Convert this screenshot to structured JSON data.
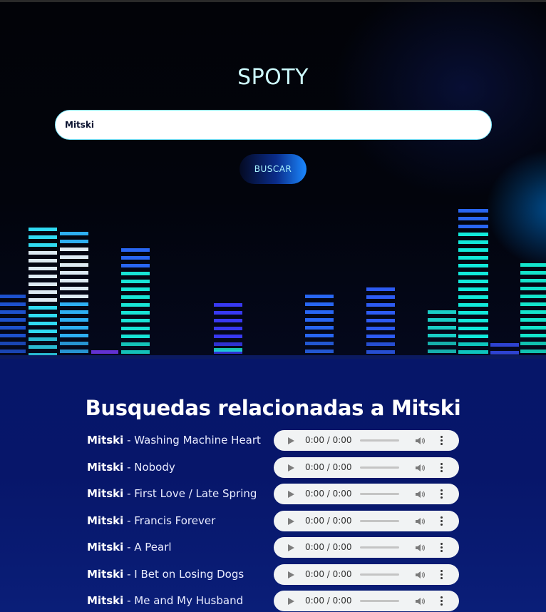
{
  "app": {
    "title": "SPOTY"
  },
  "search": {
    "value": "Mitski",
    "button_label": "BUSCAR"
  },
  "results": {
    "heading": "Busquedas relacionadas a Mitski",
    "songs": [
      {
        "artist": "Mitski",
        "separator": " - ",
        "title": "Washing Machine Heart",
        "time": "0:00 / 0:00"
      },
      {
        "artist": "Mitski",
        "separator": " - ",
        "title": "Nobody",
        "time": "0:00 / 0:00"
      },
      {
        "artist": "Mitski",
        "separator": " - ",
        "title": "First Love / Late Spring",
        "time": "0:00 / 0:00"
      },
      {
        "artist": "Mitski",
        "separator": " - ",
        "title": "Francis Forever",
        "time": "0:00 / 0:00"
      },
      {
        "artist": "Mitski",
        "separator": " - ",
        "title": "A Pearl",
        "time": "0:00 / 0:00"
      },
      {
        "artist": "Mitski",
        "separator": " - ",
        "title": "I Bet on Losing Dogs",
        "time": "0:00 / 0:00"
      },
      {
        "artist": "Mitski",
        "separator": " - ",
        "title": "Me and My Husband",
        "time": "0:00 / 0:00"
      }
    ]
  },
  "colors": {
    "accent": "#7be8ff",
    "results_bg": "#061669"
  }
}
